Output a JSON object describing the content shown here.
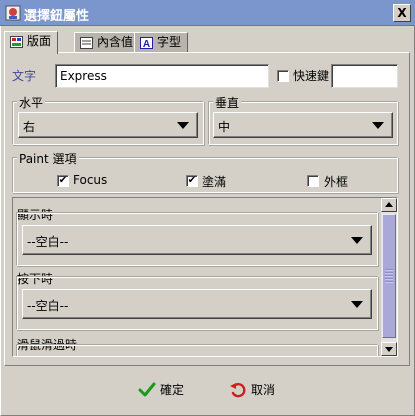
{
  "window": {
    "title": "選擇鈕屬性",
    "close_glyph": "X",
    "app_icon": "app-icon"
  },
  "tabs": [
    {
      "label": "版面",
      "icon": "layout-icon",
      "active": true
    },
    {
      "label": "內含值",
      "icon": "content-icon",
      "active": false
    },
    {
      "label": "字型",
      "icon": "font-icon",
      "active": false
    }
  ],
  "text_row": {
    "label": "文字",
    "value": "Express",
    "shortcut_label": "快速鍵",
    "shortcut_checked": false,
    "shortcut_value": ""
  },
  "horizontal": {
    "label": "水平",
    "value": "右"
  },
  "vertical": {
    "label": "垂直",
    "value": "中"
  },
  "paint": {
    "label": "Paint 選項",
    "options": [
      {
        "label": "Focus",
        "checked": true
      },
      {
        "label": "塗滿",
        "checked": true
      },
      {
        "label": "外框",
        "checked": false
      }
    ]
  },
  "states": [
    {
      "label": "顯示時",
      "value": "--空白--"
    },
    {
      "label": "按下時",
      "value": "--空白--"
    },
    {
      "label": "滑鼠滑過時",
      "value": ""
    }
  ],
  "buttons": {
    "ok_label": "確定",
    "cancel_label": "取消"
  },
  "colors": {
    "titlebar": "#7a96cc",
    "label_blue": "#44449a",
    "ok_green": "#1a9a1a",
    "cancel_red": "#cc2020"
  }
}
